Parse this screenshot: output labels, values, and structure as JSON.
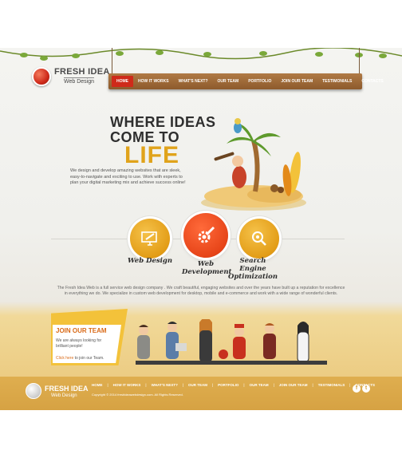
{
  "header": {
    "logo_title": "FRESH IDEA",
    "logo_subtitle": "Web Design",
    "nav": [
      {
        "label": "HOME",
        "active": true
      },
      {
        "label": "HOW IT WORKS",
        "active": false
      },
      {
        "label": "WHAT'S NEXT?",
        "active": false
      },
      {
        "label": "OUR TEAM",
        "active": false
      },
      {
        "label": "PORTFOLIO",
        "active": false
      },
      {
        "label": "JOIN OUR TEAM",
        "active": false
      },
      {
        "label": "TESTIMONIALS",
        "active": false
      },
      {
        "label": "CONTACTS",
        "active": false
      }
    ]
  },
  "hero": {
    "title_line1": "WHERE IDEAS",
    "title_line2": "COME TO",
    "title_big": "LIFE",
    "text": "We design and develop amazing websites that are sleek, easy-to-navigate and exciting to use. Work with experts to plan your digital marketing mix and achieve success online!"
  },
  "services": [
    {
      "label": "Web Design",
      "icon": "monitor-pen-icon"
    },
    {
      "label": "Web Development",
      "icon": "gear-pencil-icon"
    },
    {
      "label": "Search Engine Optimization",
      "icon": "magnifier-icon"
    }
  ],
  "about": "The Fresh Idea Web is a full service web design company . We craft beautiful, engaging websites and over the years have built up a reputation for excellence in everything we do. We specialize in custom web development for desktop, mobile and e-commerce and work with a wide range of wonderful clients.",
  "join": {
    "title": "JOIN OUR TEAM",
    "text": "We are always looking for brilliant people!",
    "link_highlight": "Click here",
    "link_rest": " to join our Team."
  },
  "footer": {
    "logo_title": "FRESH IDEA",
    "logo_subtitle": "Web Design",
    "nav": [
      "HOME",
      "HOW IT WORKS",
      "WHAT'S NEXT?",
      "OUR TEAM",
      "PORTFOLIO",
      "OUR TEAM",
      "JOIN OUR TEAM",
      "TESTIMONIALS",
      "CONTACTS"
    ],
    "copyright": "Copyright © 2014 freshideawebdesign.com. All Rights Reserved.",
    "social": [
      {
        "icon": "facebook-icon",
        "glyph": "f"
      },
      {
        "icon": "twitter-icon",
        "glyph": "t"
      }
    ]
  },
  "colors": {
    "accent_red": "#cf2a1a",
    "accent_orange": "#e39d17",
    "wood": "#8d5a2c"
  }
}
